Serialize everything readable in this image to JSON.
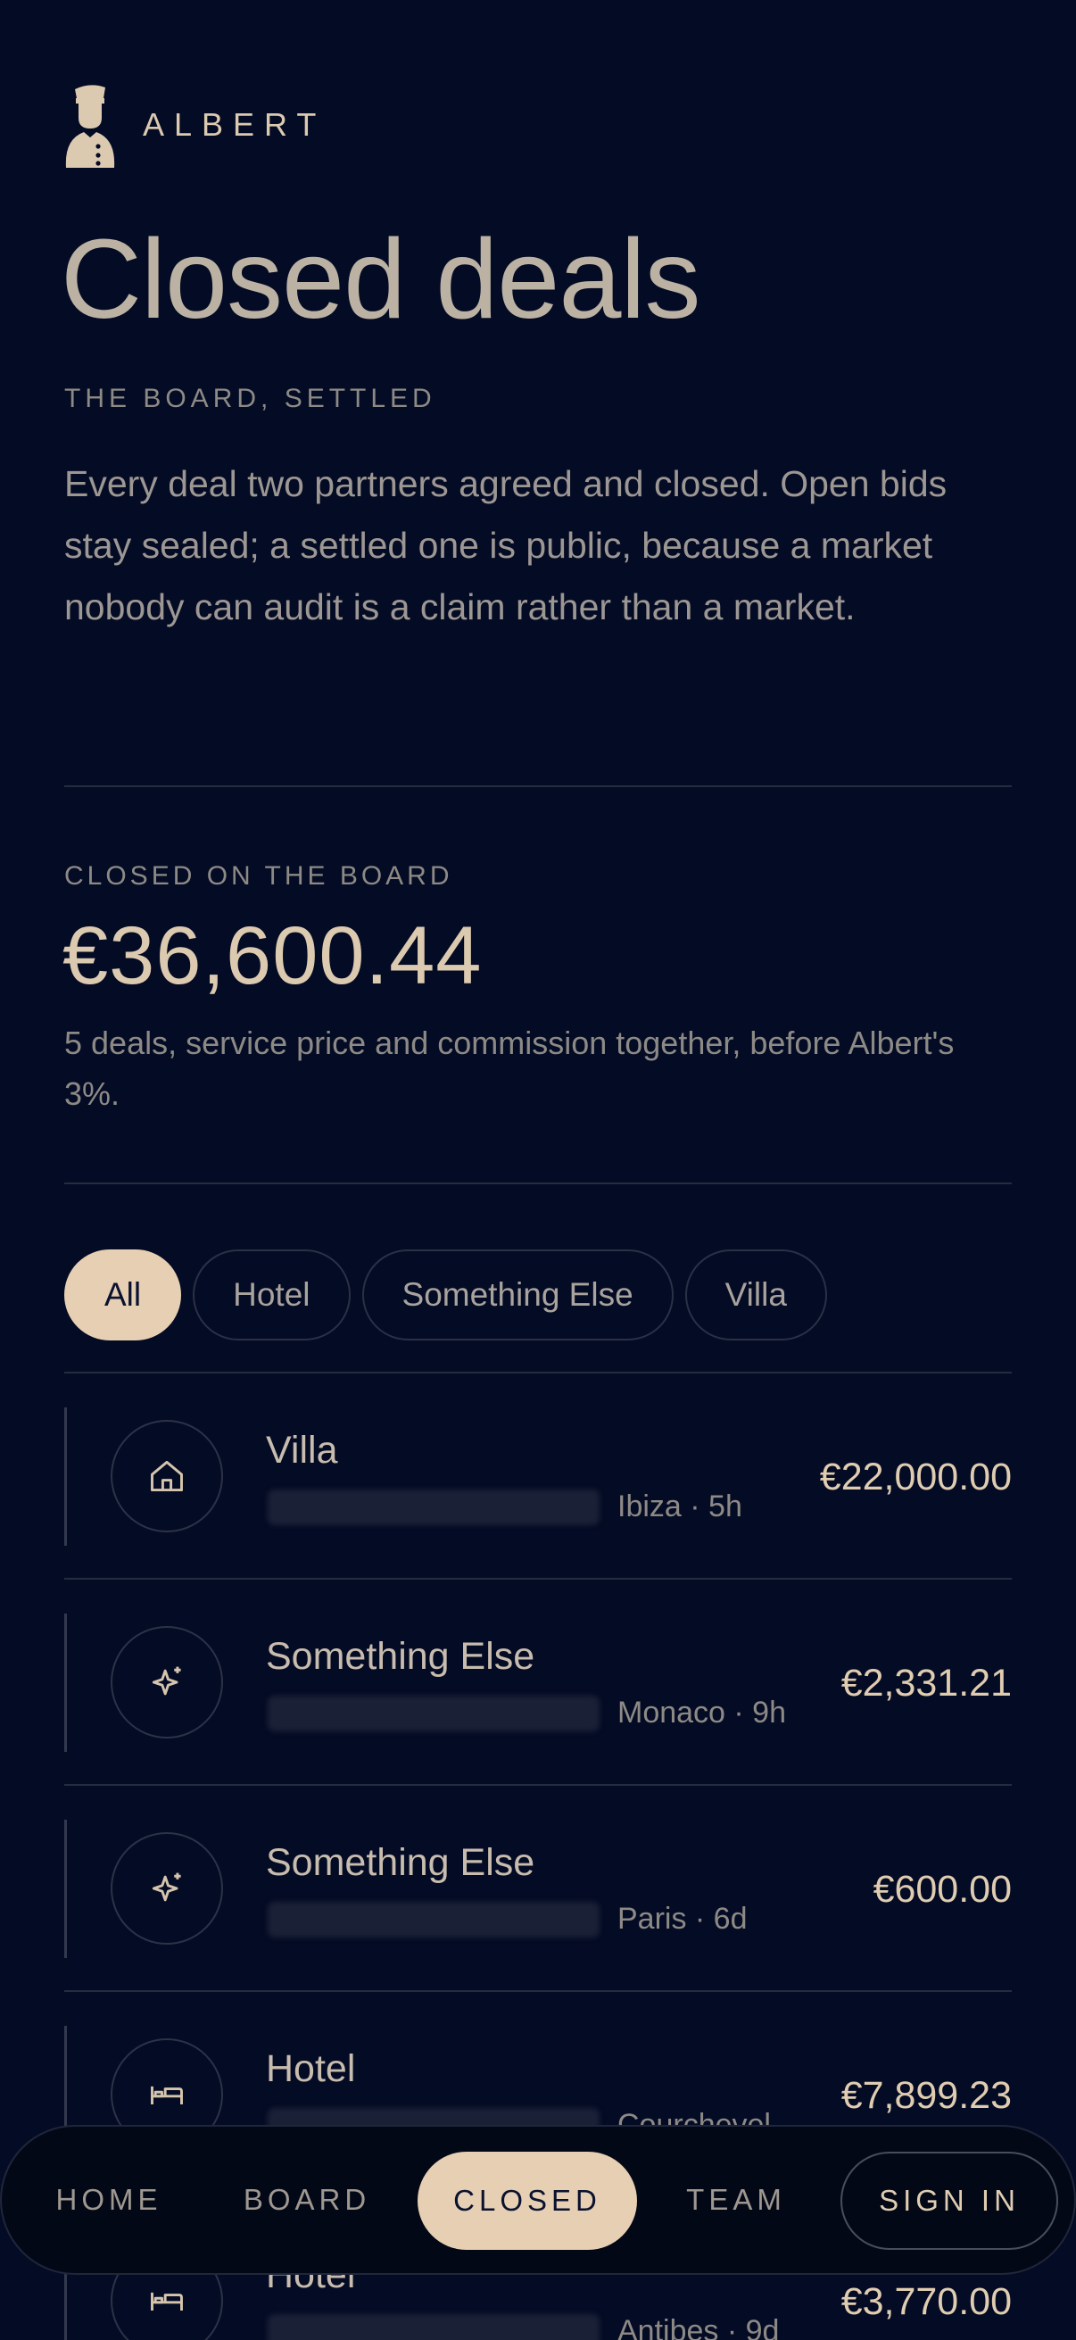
{
  "brand": {
    "name": "ALBERT",
    "logo_icon": "concierge-logo-icon"
  },
  "page": {
    "title": "Closed deals",
    "eyebrow": "THE BOARD, SETTLED",
    "intro": "Every deal two partners agreed and closed. Open bids stay sealed; a settled one is public, because a market nobody can audit is a claim rather than a market."
  },
  "summary": {
    "label": "CLOSED ON THE BOARD",
    "total": "€36,600.44",
    "note": "5 deals, service price and commission together, before Albert's 3%."
  },
  "filters": [
    {
      "label": "All",
      "active": true
    },
    {
      "label": "Hotel",
      "active": false
    },
    {
      "label": "Something Else",
      "active": false
    },
    {
      "label": "Villa",
      "active": false
    }
  ],
  "deals": [
    {
      "category": "Villa",
      "icon": "house-icon",
      "meta": "Ibiza · 5h",
      "price": "€22,000.00"
    },
    {
      "category": "Something Else",
      "icon": "sparkle-icon",
      "meta": "Monaco · 9h",
      "price": "€2,331.21"
    },
    {
      "category": "Something Else",
      "icon": "sparkle-icon",
      "meta": "Paris · 6d",
      "price": "€600.00"
    },
    {
      "category": "Hotel",
      "icon": "bed-icon",
      "meta": "Courchevel",
      "price": "€7,899.23"
    },
    {
      "category": "Hotel",
      "icon": "bed-icon",
      "meta": "Antibes · 9d",
      "price": "€3,770.00"
    }
  ],
  "nav": {
    "home": "HOME",
    "board": "BOARD",
    "closed": "CLOSED",
    "team": "TEAM",
    "sign_in": "SIGN IN",
    "active": "closed"
  },
  "colors": {
    "background": "#040b24",
    "accent": "#e6cfb2",
    "text": "#b9ae9e"
  }
}
